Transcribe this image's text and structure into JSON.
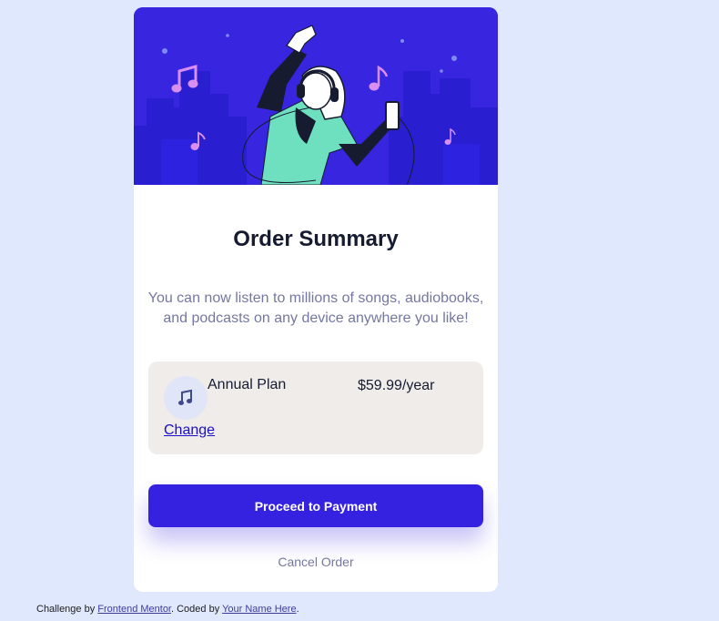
{
  "card": {
    "title": "Order Summary",
    "description": "You can now listen to millions of songs, audiobooks, and podcasts on any device anywhere you like!",
    "plan": {
      "name": "Annual Plan",
      "price": "$59.99/year",
      "change_label": "Change",
      "icon": "music-note-icon"
    },
    "proceed_label": "Proceed to Payment",
    "cancel_label": "Cancel Order"
  },
  "footer": {
    "prefix": "Challenge by ",
    "link1": "Frontend Mentor",
    "middle": ". Coded by ",
    "link2": "Your Name Here",
    "suffix": "."
  },
  "colors": {
    "page_bg": "#e0e8fe",
    "hero_bg": "#3725e0",
    "button": "#3521e0",
    "plan_bg": "#efecea",
    "text_dark": "#161b30",
    "text_muted": "#7478a0"
  }
}
